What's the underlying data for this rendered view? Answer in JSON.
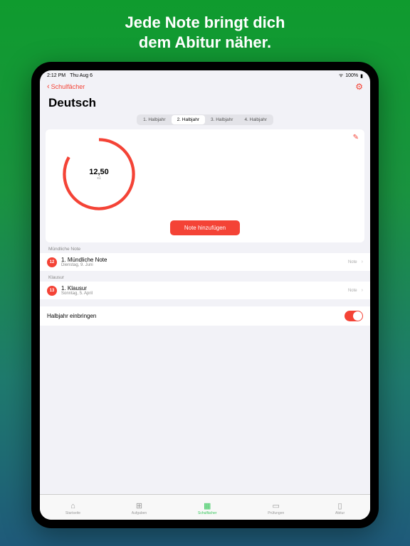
{
  "promo": {
    "line1": "Jede Note bringt dich",
    "line2": "dem Abitur näher."
  },
  "status": {
    "time": "2:12 PM",
    "date": "Thu Aug 6",
    "battery": "100%"
  },
  "nav": {
    "back_label": "Schulfächer"
  },
  "page": {
    "title": "Deutsch"
  },
  "segments": [
    "1. Halbjahr",
    "2. Halbjahr",
    "3. Halbjahr",
    "4. Halbjahr"
  ],
  "active_segment": 1,
  "chart_data": {
    "type": "pie",
    "title": "",
    "value_label": "12,50",
    "sub_label": "x1",
    "percent": 83,
    "colors": {
      "fill": "#f44336",
      "track": "transparent"
    }
  },
  "add_button": "Note hinzufügen",
  "sections": [
    {
      "label": "Mündliche Note",
      "items": [
        {
          "badge": "12",
          "title": "1. Mündliche Note",
          "date": "Dienstag, 9. Juni",
          "tag": "Note"
        }
      ]
    },
    {
      "label": "Klausur",
      "items": [
        {
          "badge": "13",
          "title": "1. Klausur",
          "date": "Sonntag, 5. April",
          "tag": "Note"
        }
      ]
    }
  ],
  "toggle": {
    "label": "Halbjahr einbringen",
    "on": true
  },
  "tabs": [
    {
      "label": "Startseite",
      "icon": "⌂"
    },
    {
      "label": "Aufgaben",
      "icon": "⊞"
    },
    {
      "label": "Schulfächer",
      "icon": "▦"
    },
    {
      "label": "Prüfungen",
      "icon": "▭"
    },
    {
      "label": "Abitur",
      "icon": "▯"
    }
  ],
  "active_tab": 2
}
